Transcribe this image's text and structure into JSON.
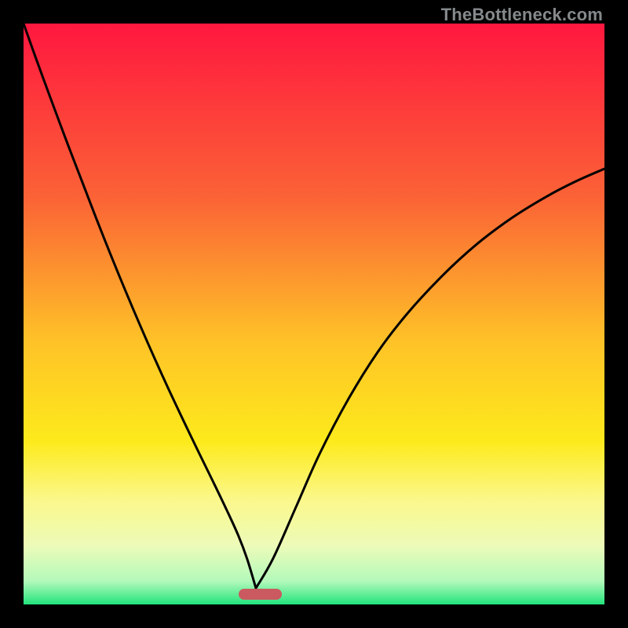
{
  "watermark": {
    "text": "TheBottleneck.com"
  },
  "gradient": {
    "stops": [
      {
        "offset": 0.0,
        "color": "#ff173f"
      },
      {
        "offset": 0.3,
        "color": "#fb6336"
      },
      {
        "offset": 0.55,
        "color": "#fec327"
      },
      {
        "offset": 0.72,
        "color": "#fdea1c"
      },
      {
        "offset": 0.82,
        "color": "#fbf88b"
      },
      {
        "offset": 0.9,
        "color": "#ecfbb9"
      },
      {
        "offset": 0.96,
        "color": "#b3f9ba"
      },
      {
        "offset": 1.0,
        "color": "#22e47c"
      }
    ]
  },
  "chart_data": {
    "type": "line",
    "title": "",
    "xlabel": "",
    "ylabel": "",
    "xlim": [
      0,
      1
    ],
    "ylim": [
      0,
      1
    ],
    "x_min_fraction": 0.4,
    "marker": {
      "x_start": 0.37,
      "x_end": 0.445,
      "y": 0.975,
      "color": "#ca5a60"
    },
    "series": [
      {
        "name": "left-curve",
        "x": [
          0.0,
          0.025,
          0.05,
          0.075,
          0.1,
          0.125,
          0.15,
          0.175,
          0.2,
          0.225,
          0.25,
          0.275,
          0.3,
          0.325,
          0.35,
          0.37,
          0.385,
          0.4
        ],
        "y": [
          1.0,
          0.93,
          0.862,
          0.795,
          0.73,
          0.665,
          0.602,
          0.541,
          0.482,
          0.425,
          0.37,
          0.317,
          0.265,
          0.214,
          0.162,
          0.118,
          0.078,
          0.028
        ]
      },
      {
        "name": "right-curve",
        "x": [
          0.4,
          0.43,
          0.47,
          0.51,
          0.56,
          0.61,
          0.66,
          0.72,
          0.78,
          0.84,
          0.9,
          0.95,
          1.0
        ],
        "y": [
          0.028,
          0.08,
          0.17,
          0.26,
          0.355,
          0.435,
          0.5,
          0.565,
          0.62,
          0.665,
          0.702,
          0.728,
          0.75
        ]
      }
    ]
  }
}
